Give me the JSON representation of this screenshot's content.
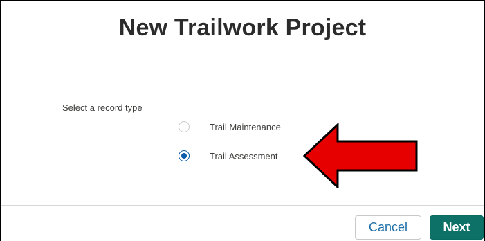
{
  "modal": {
    "title": "New Trailwork Project"
  },
  "record_type": {
    "prompt": "Select a record type",
    "options": [
      {
        "label": "Trail Maintenance",
        "selected": false
      },
      {
        "label": "Trail Assessment",
        "selected": true
      }
    ]
  },
  "annotation": {
    "arrow_color": "#e60000",
    "arrow_outline": "#000000",
    "arrow_direction": "left"
  },
  "footer": {
    "cancel_label": "Cancel",
    "next_label": "Next"
  },
  "colors": {
    "primary_button": "#0d7168",
    "radio_selected": "#0b5cab",
    "link_text": "#1f6fa8"
  }
}
